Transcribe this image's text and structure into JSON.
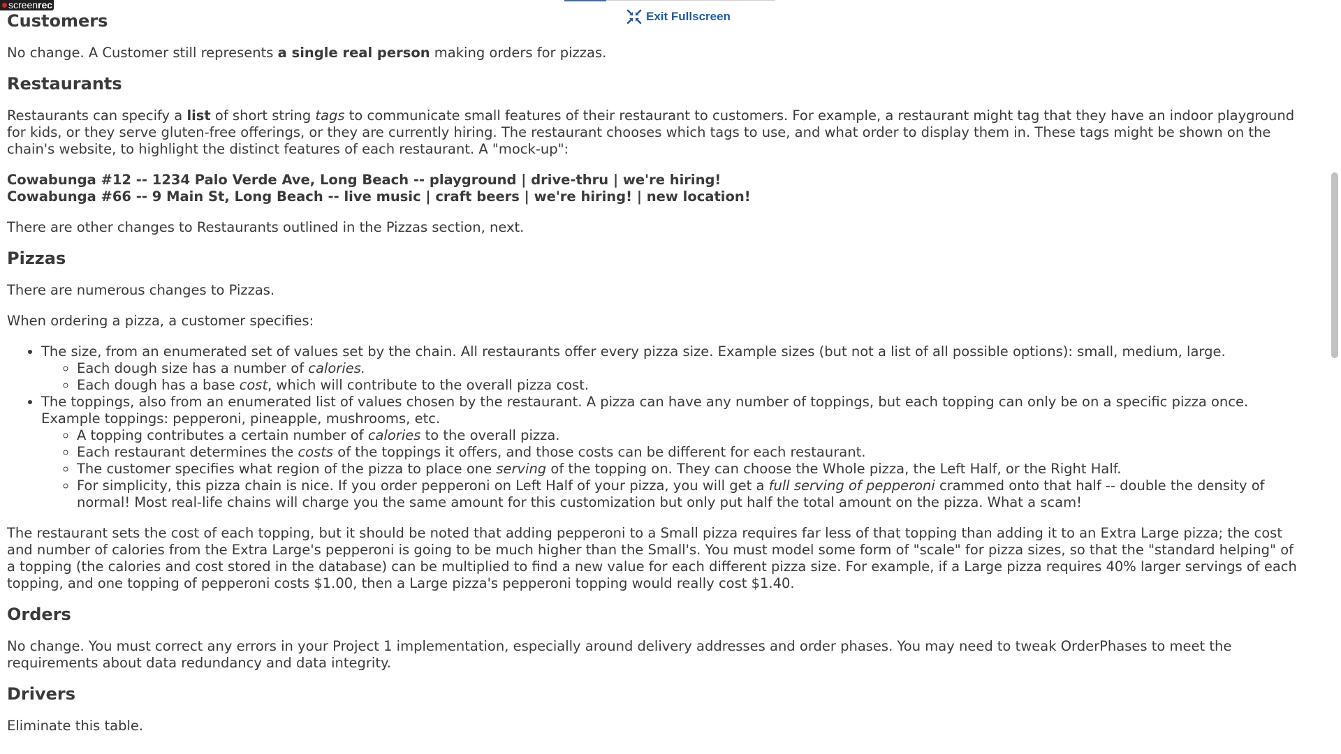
{
  "recorder": {
    "brand_thin": "screen",
    "brand_bold": "rec"
  },
  "header": {
    "exit_fullscreen_label": "Exit Fullscreen"
  },
  "sections": {
    "customers": {
      "heading": "Customers",
      "p1_a": "No change. A Customer still represents ",
      "p1_b": "a single real person",
      "p1_c": " making orders for pizzas."
    },
    "restaurants": {
      "heading": "Restaurants",
      "p1_a": "Restaurants can specify a ",
      "p1_b": "list",
      "p1_c": " of short string ",
      "p1_d": "tags",
      "p1_e": " to communicate small features of their restaurant to customers. For example, a restaurant might tag that they have an indoor playground for kids, or they serve gluten-free offerings, or they are currently hiring. The restaurant chooses which tags to use, and what order to display them in. These tags might be shown on the chain's website, to highlight the distinct features of each restaurant. A \"mock-up\":",
      "mockup_line1": "Cowabunga #12 -- 1234 Palo Verde Ave, Long Beach -- playground | drive-thru | we're hiring!",
      "mockup_line2": "Cowabunga #66 -- 9 Main St, Long Beach -- live music | craft beers | we're hiring! | new location!",
      "p2": "There are other changes to Restaurants outlined in the Pizzas section, next."
    },
    "pizzas": {
      "heading": "Pizzas",
      "p1": "There are numerous changes to Pizzas.",
      "p2": "When ordering a pizza, a customer specifies:",
      "b1": "The size, from an enumerated set of values set by the chain. All restaurants offer every pizza size. Example sizes (but not a list of all possible options): small, medium, large.",
      "b1_s1_a": "Each dough size has a number of ",
      "b1_s1_b": "calories.",
      "b1_s2_a": "Each dough has a base ",
      "b1_s2_b": "cost",
      "b1_s2_c": ", which will contribute to the overall pizza cost.",
      "b2": "The toppings, also from an enumerated list of values chosen by the restaurant. A pizza can have any number of toppings, but each topping can only be on a specific pizza once. Example toppings: pepperoni, pineapple, mushrooms, etc.",
      "b2_s1_a": "A topping contributes a certain number of ",
      "b2_s1_b": "calories",
      "b2_s1_c": " to the overall pizza.",
      "b2_s2_a": "Each restaurant determines the ",
      "b2_s2_b": "costs",
      "b2_s2_c": " of the toppings it offers, and those costs can be different for each restaurant.",
      "b2_s3_a": "The customer specifies what region of the pizza to place one ",
      "b2_s3_b": "serving",
      "b2_s3_c": " of the topping on. They can choose the Whole pizza, the Left Half, or the Right Half.",
      "b2_s4_a": "For simplicity, this pizza chain is nice. If you order pepperoni on Left Half of your pizza, you will get a ",
      "b2_s4_b": "full serving of pepperoni",
      "b2_s4_c": " crammed onto that half -- double the density of normal! Most real-life chains will charge you the same amount for this customization but only put half the total amount on the pizza. What a scam!",
      "p3": "The restaurant sets the cost of each topping, but it should be noted that adding pepperoni to a Small pizza requires far less of that topping than adding it to an Extra Large pizza; the cost and number of calories from the Extra Large's pepperoni is going to be much higher than the Small's. You must model some form of \"scale\" for pizza sizes, so that the \"standard helping\" of a topping (the calories and cost stored in the database) can be multiplied to find a new value for each different pizza size. For example, if a Large pizza requires 40% larger servings of each topping, and one topping of pepperoni costs $1.00, then a Large pizza's pepperoni topping would really cost $1.40."
    },
    "orders": {
      "heading": "Orders",
      "p1": "No change. You must correct any errors in your Project 1 implementation, especially around delivery addresses and order phases. You may need to tweak OrderPhases to meet the requirements about data redundancy and data integrity."
    },
    "drivers": {
      "heading": "Drivers",
      "p1": "Eliminate this table."
    }
  },
  "colors": {
    "text": "#3a3a3a",
    "link": "#1f5aa6",
    "scroll_thumb": "#c1c1c1"
  }
}
